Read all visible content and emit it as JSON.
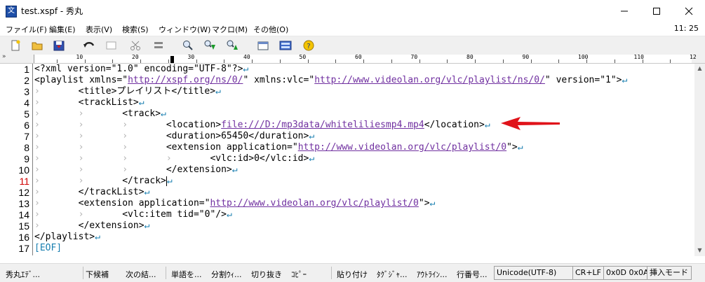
{
  "window": {
    "title": "test.xspf - 秀丸",
    "app_icon_glyph": "文"
  },
  "menu": {
    "items": [
      "ファイル(F)",
      "編集(E)",
      "表示(V)",
      "検索(S)",
      "ウィンドウ(W)",
      "マクロ(M)",
      "その他(O)"
    ],
    "clock": "11: 25"
  },
  "ruler": {
    "gutter_mark": "»",
    "labels": [
      "10",
      "20",
      "30",
      "40",
      "50",
      "60",
      "70",
      "80",
      "90",
      "100",
      "110",
      "12"
    ]
  },
  "editor": {
    "lines": [
      {
        "num": "1",
        "html": "&lt;?xml version=\"1.0\" encoding=\"UTF-8\"?&gt;<span class='nl'>↵</span>"
      },
      {
        "num": "2",
        "html": "&lt;playlist xmlns=\"<span class='url'>http://xspf.org/ns/0/</span>\" xmlns:vlc=\"<span class='url'>http://www.videolan.org/vlc/playlist/ns/0/</span>\" version=\"1\"&gt;<span class='nl'>↵</span>"
      },
      {
        "num": "3",
        "html": "<span class='tabmark'>›       </span>&lt;title&gt;プレイリスト&lt;/title&gt;<span class='nl'>↵</span>"
      },
      {
        "num": "4",
        "html": "<span class='tabmark'>›       </span>&lt;trackList&gt;<span class='nl'>↵</span>"
      },
      {
        "num": "5",
        "html": "<span class='tabmark'>›       ›       </span>&lt;track&gt;<span class='nl'>↵</span>"
      },
      {
        "num": "6",
        "html": "<span class='tabmark'>›       ›       ›       </span>&lt;location&gt;<span class='url'>file:///D:/mp3data/whiteliliesmp4.mp4</span>&lt;/location&gt;<span class='nl'>↵</span>"
      },
      {
        "num": "7",
        "html": "<span class='tabmark'>›       ›       ›       </span>&lt;duration&gt;65450&lt;/duration&gt;<span class='nl'>↵</span>"
      },
      {
        "num": "8",
        "html": "<span class='tabmark'>›       ›       ›       </span>&lt;extension application=\"<span class='url'>http://www.videolan.org/vlc/playlist/0</span>\"&gt;<span class='nl'>↵</span>"
      },
      {
        "num": "9",
        "html": "<span class='tabmark'>›       ›       ›       ›       </span>&lt;vlc:id&gt;0&lt;/vlc:id&gt;<span class='nl'>↵</span>"
      },
      {
        "num": "10",
        "html": "<span class='tabmark'>›       ›       ›       </span>&lt;/extension&gt;<span class='nl'>↵</span>"
      },
      {
        "num": "11",
        "html": "<span class='tabmark'>›       ›       </span>&lt;/track&gt;<span class='caret'></span><span class='nl'>↵</span>",
        "current": true
      },
      {
        "num": "12",
        "html": "<span class='tabmark'>›       </span>&lt;/trackList&gt;<span class='nl'>↵</span>"
      },
      {
        "num": "13",
        "html": "<span class='tabmark'>›       </span>&lt;extension application=\"<span class='url'>http://www.videolan.org/vlc/playlist/0</span>\"&gt;<span class='nl'>↵</span>"
      },
      {
        "num": "14",
        "html": "<span class='tabmark'>›       ›       </span>&lt;vlc:item tid=\"0\"/&gt;<span class='nl'>↵</span>"
      },
      {
        "num": "15",
        "html": "<span class='tabmark'>›       </span>&lt;/extension&gt;<span class='nl'>↵</span>"
      },
      {
        "num": "16",
        "html": "&lt;/playlist&gt;<span class='nl'>↵</span>"
      },
      {
        "num": "17",
        "html": "<span class='eof'>[EOF]</span>"
      }
    ]
  },
  "annotation": {
    "arrow_color": "#e0131a"
  },
  "statusbar": {
    "items": [
      "秀丸ｴﾃﾞ...",
      "下候補",
      "次の結...",
      "単語を...",
      "分割ｳｨ...",
      "切り抜き",
      "ｺﾋﾟｰ",
      "貼り付け",
      "ﾀｸﾞｼﾞｬ...",
      "ｱｳﾄﾗｲﾝ...",
      "行番号..."
    ],
    "encoding": "Unicode(UTF-8)",
    "newline": "CR+LF",
    "char_code": "0x0D 0x0A",
    "mode": "挿入モード"
  }
}
